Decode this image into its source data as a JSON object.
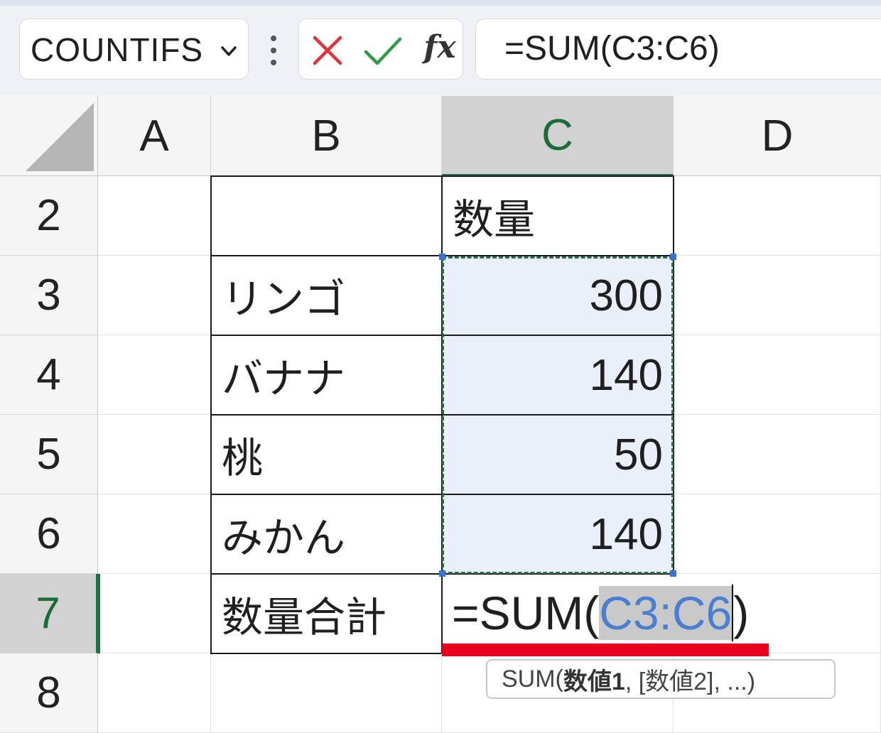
{
  "formula_bar": {
    "name_box": "COUNTIFS",
    "actions": {
      "cancel_icon": "x-icon",
      "enter_icon": "check-icon",
      "function_icon": "fx"
    },
    "formula": "=SUM(C3:C6)"
  },
  "columns": [
    "A",
    "B",
    "C",
    "D"
  ],
  "rows": [
    "2",
    "3",
    "4",
    "5",
    "6",
    "7",
    "8"
  ],
  "cells": {
    "C2": "数量",
    "B3": "リンゴ",
    "C3": "300",
    "B4": "バナナ",
    "C4": "140",
    "B5": "桃",
    "C5": "50",
    "B6": "みかん",
    "C6": "140",
    "B7": "数量合計"
  },
  "editing": {
    "cell": "C7",
    "prefix": "=SUM(",
    "ref": "C3:C6",
    "suffix": ")"
  },
  "tooltip": {
    "fn": "SUM(",
    "arg1": "数値1",
    "rest": ", [数値2], ...)"
  },
  "colors": {
    "accent_green": "#1e7145",
    "ref_blue": "#4a7fd0",
    "underline_red": "#e8001c"
  }
}
